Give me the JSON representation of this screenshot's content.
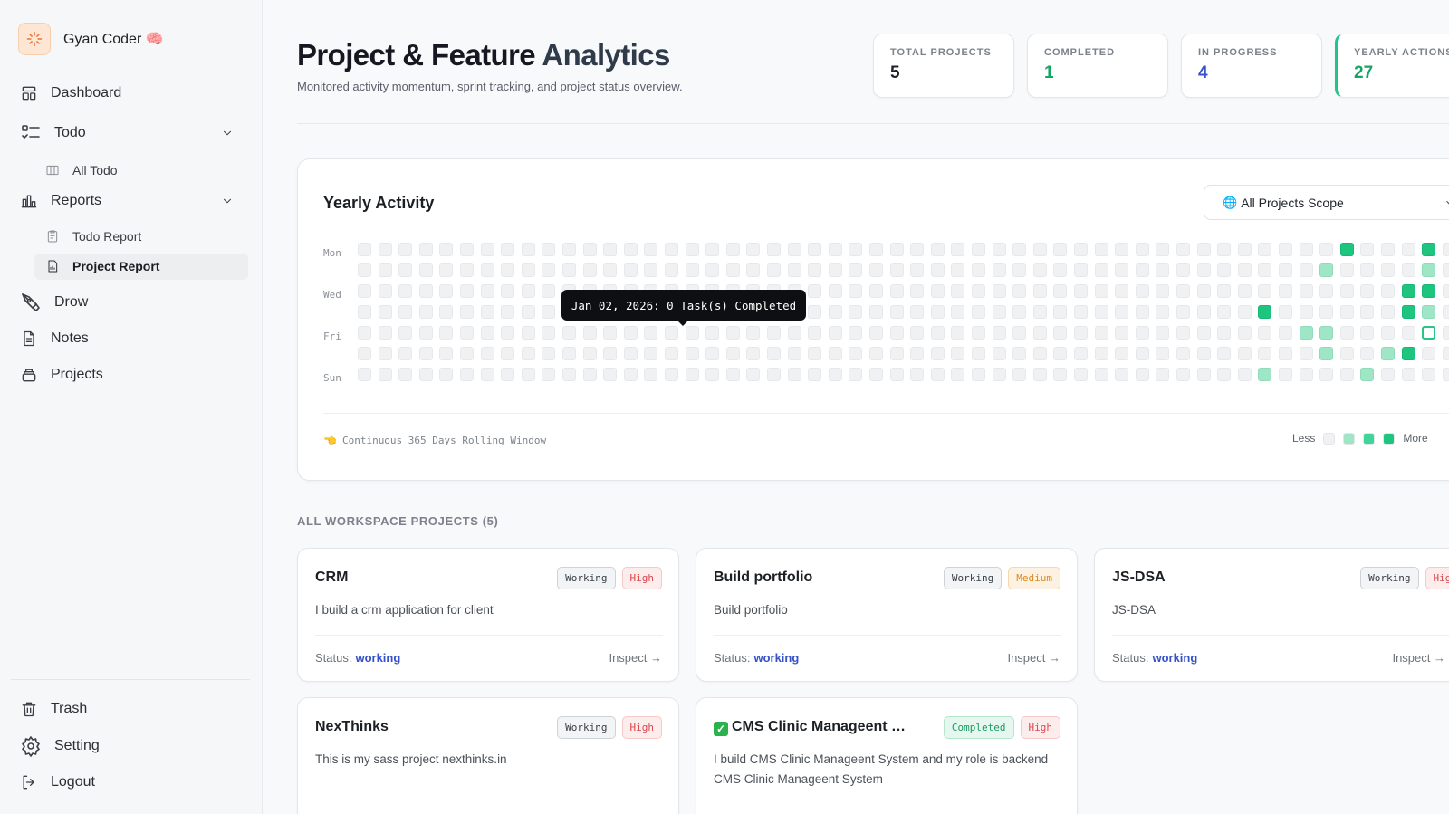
{
  "brand": {
    "name": "Gyan Coder 🧠"
  },
  "sidebar": {
    "dashboard": "Dashboard",
    "todo": "Todo",
    "all_todo": "All Todo",
    "reports": "Reports",
    "todo_report": "Todo Report",
    "project_report": "Project Report",
    "drow": "Drow",
    "notes": "Notes",
    "projects": "Projects",
    "trash": "Trash",
    "setting": "Setting",
    "logout": "Logout"
  },
  "header": {
    "title_main": "Project & Feature ",
    "title_accent": "Analytics",
    "subtitle": "Monitored activity momentum, sprint tracking, and project status overview."
  },
  "stats": [
    {
      "label": "TOTAL PROJECTS",
      "value": "5",
      "color": "#1e2227"
    },
    {
      "label": "COMPLETED",
      "value": "1",
      "color": "#18a467"
    },
    {
      "label": "IN PROGRESS",
      "value": "4",
      "color": "#3453cc"
    },
    {
      "label": "YEARLY ACTIONS",
      "value": "27",
      "color": "#18a467"
    }
  ],
  "activity": {
    "title": "Yearly Activity",
    "scope": "All Projects Scope",
    "days": [
      "Mon",
      "Wed",
      "Fri",
      "Sun"
    ],
    "tooltip": "Jan 02, 2026: 0 Task(s) Completed",
    "footnote": "Continuous 365 Days Rolling Window",
    "legend_less": "Less",
    "legend_more": "More",
    "legend_colors": [
      "#f0f1f3",
      "#9fe6c6",
      "#3fd599",
      "#1ec57f"
    ],
    "active_cells": [
      {
        "col": 48,
        "row": 0,
        "level": 3
      },
      {
        "col": 52,
        "row": 0,
        "level": 3
      },
      {
        "col": 47,
        "row": 1,
        "level": 1
      },
      {
        "col": 52,
        "row": 1,
        "level": 1
      },
      {
        "col": 51,
        "row": 2,
        "level": 3
      },
      {
        "col": 52,
        "row": 2,
        "level": 3
      },
      {
        "col": 44,
        "row": 3,
        "level": 3
      },
      {
        "col": 51,
        "row": 3,
        "level": 3
      },
      {
        "col": 52,
        "row": 3,
        "level": 1
      },
      {
        "col": 46,
        "row": 4,
        "level": 1
      },
      {
        "col": 47,
        "row": 4,
        "level": 1
      },
      {
        "col": 52,
        "row": 4,
        "level": "sel"
      },
      {
        "col": 47,
        "row": 5,
        "level": 1
      },
      {
        "col": 50,
        "row": 5,
        "level": 1
      },
      {
        "col": 51,
        "row": 5,
        "level": 3
      },
      {
        "col": 44,
        "row": 6,
        "level": 1
      },
      {
        "col": 49,
        "row": 6,
        "level": 1
      }
    ]
  },
  "projects_section": {
    "title": "ALL WORKSPACE PROJECTS (5)"
  },
  "projects": [
    {
      "name": "CRM",
      "completed": false,
      "status_badge": "Working",
      "priority": "High",
      "desc": "I build a crm application for client",
      "status_label": "Status:",
      "status": "working",
      "inspect": "Inspect →"
    },
    {
      "name": "Build portfolio",
      "completed": false,
      "status_badge": "Working",
      "priority": "Medium",
      "desc": "Build portfolio",
      "status_label": "Status:",
      "status": "working",
      "inspect": "Inspect →"
    },
    {
      "name": "JS-DSA",
      "completed": false,
      "status_badge": "Working",
      "priority": "High",
      "desc": "JS-DSA",
      "status_label": "Status:",
      "status": "working",
      "inspect": "Inspect →"
    },
    {
      "name": "NexThinks",
      "completed": false,
      "status_badge": "Working",
      "priority": "High",
      "desc": "This is my sass project nexthinks.in",
      "status_label": "",
      "status": "",
      "inspect": ""
    },
    {
      "name": "CMS Clinic Manageent System",
      "completed": true,
      "status_badge": "Completed",
      "priority": "High",
      "desc": "I build CMS Clinic Manageent System and my role is backend CMS Clinic Manageent System",
      "status_label": "",
      "status": "",
      "inspect": ""
    }
  ]
}
